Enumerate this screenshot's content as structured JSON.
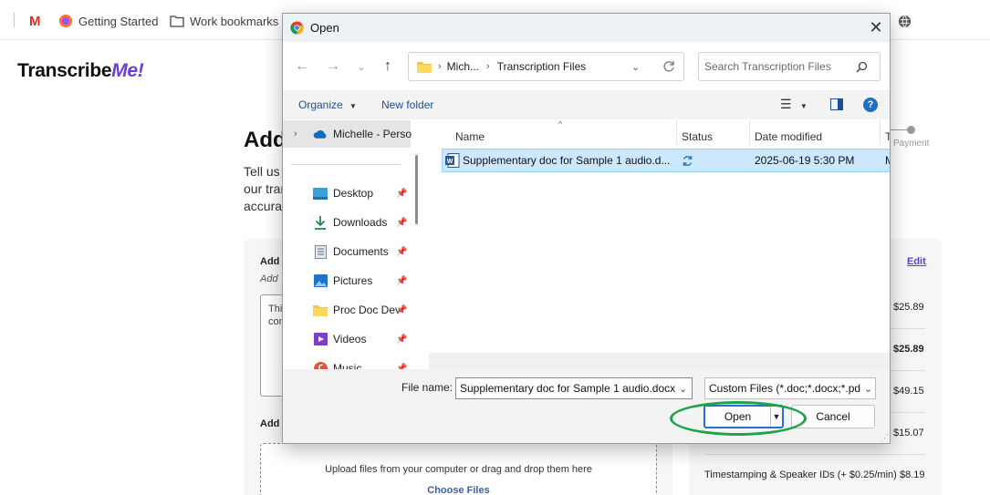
{
  "browser": {
    "bookmarks": [
      "Getting Started",
      "Work bookmarks"
    ]
  },
  "page": {
    "logo_main": "Transcribe",
    "logo_accent": "Me!",
    "heading": "Add",
    "intro_lines": [
      "Tell us",
      "our tran",
      "accurat"
    ],
    "step_label": "Payment",
    "left_card": {
      "label1": "Add",
      "sub1": "Add",
      "textarea_lines": [
        "Thi",
        "con"
      ],
      "label2": "Add",
      "drop_text": "Upload files from your computer or drag and drop them here",
      "choose_files": "Choose Files"
    },
    "right_card": {
      "edit": "Edit",
      "prices": [
        "$25.89",
        "$25.89",
        "$49.15",
        "$15.07",
        "$8.19"
      ],
      "timestamping_label": "Timestamping & Speaker IDs (+ $0.25/min)"
    }
  },
  "dialog": {
    "title": "Open",
    "address": {
      "crumb1": "Mich...",
      "crumb2": "Transcription Files"
    },
    "search_placeholder": "Search Transcription Files",
    "toolbar": {
      "organize": "Organize",
      "new_folder": "New folder"
    },
    "nav_items": [
      {
        "label": "Michelle - Perso",
        "icon": "onedrive-icon"
      },
      {
        "label": "Desktop",
        "icon": "desktop-icon"
      },
      {
        "label": "Downloads",
        "icon": "downloads-icon"
      },
      {
        "label": "Documents",
        "icon": "documents-icon"
      },
      {
        "label": "Pictures",
        "icon": "pictures-icon"
      },
      {
        "label": "Proc Doc Dev",
        "icon": "folder-icon"
      },
      {
        "label": "Videos",
        "icon": "videos-icon"
      },
      {
        "label": "Music",
        "icon": "music-icon"
      }
    ],
    "columns": {
      "name": "Name",
      "status": "Status",
      "date": "Date modified",
      "type": "T"
    },
    "files": [
      {
        "name": "Supplementary doc for Sample 1 audio.d...",
        "date": "2025-06-19 5:30 PM",
        "type": "M"
      }
    ],
    "file_name_label": "File name:",
    "file_name_value": "Supplementary doc for Sample 1 audio.docx",
    "filter": "Custom Files (*.doc;*.docx;*.pd",
    "open_label": "Open",
    "cancel_label": "Cancel"
  },
  "colors": {
    "accent": "#6b3fd6",
    "selection": "#cce8ff",
    "highlight_ring": "#1ea24a",
    "primary_button_border": "#2b6dd6"
  }
}
